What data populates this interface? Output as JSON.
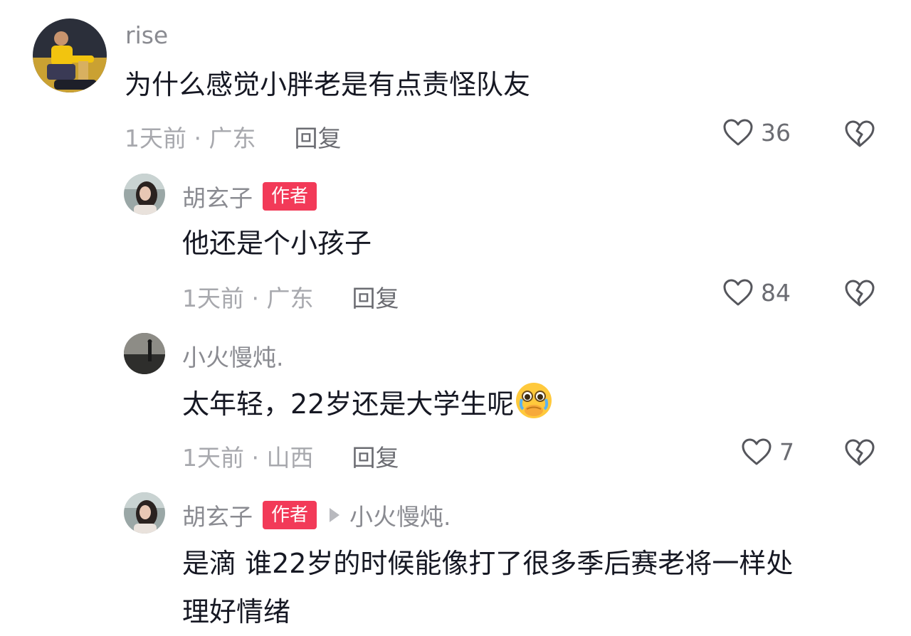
{
  "comments": [
    {
      "user": "rise",
      "text": "为什么感觉小胖老是有点责怪队友",
      "meta": "1天前 · 广东",
      "reply_label": "回复",
      "likes": "36"
    },
    {
      "user": "胡玄子",
      "badge": "作者",
      "text": "他还是个小孩子",
      "meta": "1天前 · 广东",
      "reply_label": "回复",
      "likes": "84"
    },
    {
      "user": "小火慢炖.",
      "text": "太年轻，22岁还是大学生呢",
      "meta": "1天前 · 山西",
      "reply_label": "回复",
      "likes": "7"
    },
    {
      "user": "胡玄子",
      "badge": "作者",
      "reply_to": "小火慢炖.",
      "text_line1": "是滴 谁22岁的时候能像打了很多季后赛老将一样处",
      "text_line2": "理好情绪"
    }
  ],
  "colors": {
    "author_badge": "#f23a58",
    "name_gray": "#8a8b91",
    "meta_gray": "#a7a8ad"
  }
}
